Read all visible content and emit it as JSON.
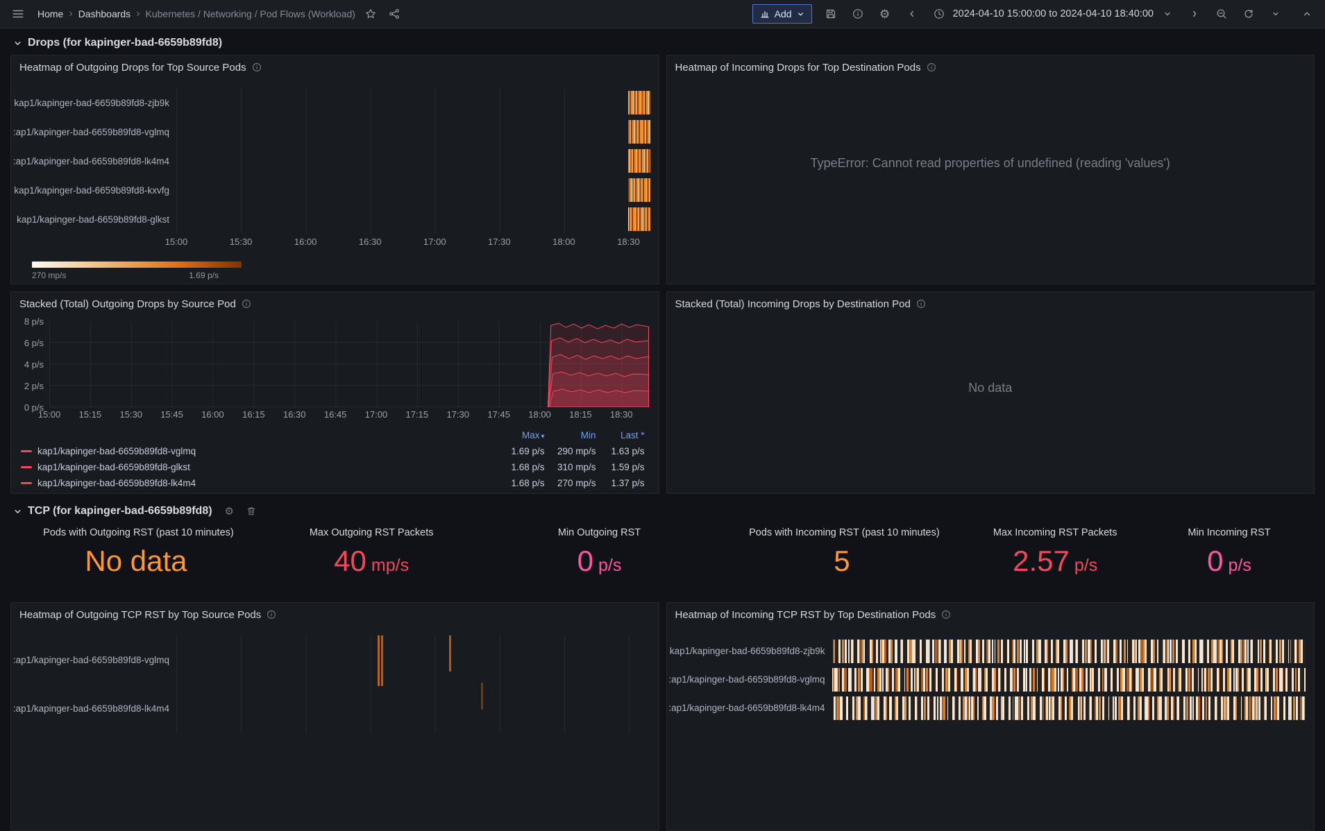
{
  "nav": {
    "breadcrumb": {
      "home": "Home",
      "dashboards": "Dashboards",
      "current": "Kubernetes / Networking / Pod Flows (Workload)"
    },
    "add_label": "Add",
    "time_range": "2024-04-10 15:00:00 to 2024-04-10 18:40:00"
  },
  "icons": {
    "breadcrumb_separator": "›",
    "gear": "⚙",
    "sort_caret": "▾"
  },
  "colors": {
    "accent_blue": "#4e78d0",
    "red": "#f2495c",
    "orange": "#ff9830",
    "pink": "#ff55a3",
    "heatmap_orange": "#e8772a",
    "legend_link_blue": "#6e9fff"
  },
  "row_drops": {
    "title": "Drops (for kapinger-bad-6659b89fd8)"
  },
  "row_tcp": {
    "title": "TCP (for kapinger-bad-6659b89fd8)"
  },
  "heatmap_out_drops": {
    "title": "Heatmap of Outgoing Drops for Top Source Pods",
    "y_labels": [
      "kap1/kapinger-bad-6659b89fd8-zjb9k",
      ":ap1/kapinger-bad-6659b89fd8-vglmq",
      ":ap1/kapinger-bad-6659b89fd8-lk4m4",
      "kap1/kapinger-bad-6659b89fd8-kxvfg",
      "kap1/kapinger-bad-6659b89fd8-glkst"
    ],
    "x_ticks": [
      "15:00",
      "15:30",
      "16:00",
      "16:30",
      "17:00",
      "17:30",
      "18:00",
      "18:30"
    ],
    "scale_min": "270 mp/s",
    "scale_max": "1.69 p/s"
  },
  "heatmap_in_drops": {
    "title": "Heatmap of Incoming Drops for Top Destination Pods",
    "error": "TypeError: Cannot read properties of undefined (reading 'values')"
  },
  "stacked_out": {
    "title": "Stacked (Total) Outgoing Drops by Source Pod",
    "y_ticks": [
      "8 p/s",
      "6 p/s",
      "4 p/s",
      "2 p/s",
      "0 p/s"
    ],
    "x_ticks": [
      "15:00",
      "15:15",
      "15:30",
      "15:45",
      "16:00",
      "16:15",
      "16:30",
      "16:45",
      "17:00",
      "17:15",
      "17:30",
      "17:45",
      "18:00",
      "18:15",
      "18:30"
    ],
    "legend_cols": {
      "max": "Max",
      "min": "Min",
      "last": "Last *"
    },
    "legend_rows": [
      {
        "name": "kap1/kapinger-bad-6659b89fd8-vglmq",
        "max": "1.69 p/s",
        "min": "290 mp/s",
        "last": "1.63 p/s"
      },
      {
        "name": "kap1/kapinger-bad-6659b89fd8-glkst",
        "max": "1.68 p/s",
        "min": "310 mp/s",
        "last": "1.59 p/s"
      },
      {
        "name": "kap1/kapinger-bad-6659b89fd8-lk4m4",
        "max": "1.68 p/s",
        "min": "270 mp/s",
        "last": "1.37 p/s"
      }
    ]
  },
  "stacked_in": {
    "title": "Stacked (Total) Incoming Drops by Destination Pod",
    "message": "No data"
  },
  "stats": [
    {
      "title": "Pods with Outgoing RST (past 10 minutes)",
      "value": "No data",
      "unit": "",
      "color": "#ff9830"
    },
    {
      "title": "Max Outgoing RST Packets",
      "value": "40",
      "unit": "mp/s",
      "color": "#f2495c"
    },
    {
      "title": "Min Outgoing RST",
      "value": "0",
      "unit": "p/s",
      "color": "#ff55a3"
    },
    {
      "title": "Pods with Incoming RST (past 10 minutes)",
      "value": "5",
      "unit": "",
      "color": "#ff9830"
    },
    {
      "title": "Max Incoming RST Packets",
      "value": "2.57",
      "unit": "p/s",
      "color": "#f2495c"
    },
    {
      "title": "Min Incoming RST",
      "value": "0",
      "unit": "p/s",
      "color": "#ff55a3"
    }
  ],
  "heatmap_out_rst": {
    "title": "Heatmap of Outgoing TCP RST by Top Source Pods",
    "y_labels": [
      ":ap1/kapinger-bad-6659b89fd8-vglmq",
      ":ap1/kapinger-bad-6659b89fd8-lk4m4"
    ]
  },
  "heatmap_in_rst": {
    "title": "Heatmap of Incoming TCP RST by Top Destination Pods",
    "y_labels": [
      "kap1/kapinger-bad-6659b89fd8-zjb9k",
      ":ap1/kapinger-bad-6659b89fd8-vglmq",
      ":ap1/kapinger-bad-6659b89fd8-lk4m4"
    ]
  },
  "chart_data": [
    {
      "type": "heatmap",
      "title": "Heatmap of Outgoing Drops for Top Source Pods",
      "y_categories": [
        "kap1/kapinger-bad-6659b89fd8-zjb9k",
        ":ap1/kapinger-bad-6659b89fd8-vglmq",
        ":ap1/kapinger-bad-6659b89fd8-lk4m4",
        "kap1/kapinger-bad-6659b89fd8-kxvfg",
        "kap1/kapinger-bad-6659b89fd8-glkst"
      ],
      "x_ticks": [
        "15:00",
        "15:30",
        "16:00",
        "16:30",
        "17:00",
        "17:30",
        "18:00",
        "18:30"
      ],
      "x_range": [
        "15:00",
        "18:40"
      ],
      "color_scale": {
        "min_label": "270 mp/s",
        "max_label": "1.69 p/s"
      },
      "cells_note": "all five pods show orange drop activity only between ~18:28 and 18:40; rest of range empty"
    },
    {
      "type": "area",
      "stacked": true,
      "title": "Stacked (Total) Outgoing Drops by Source Pod",
      "ylim": [
        0,
        8
      ],
      "y_ticks": [
        "0 p/s",
        "2 p/s",
        "4 p/s",
        "6 p/s",
        "8 p/s"
      ],
      "x_ticks": [
        "15:00",
        "15:15",
        "15:30",
        "15:45",
        "16:00",
        "16:15",
        "16:30",
        "16:45",
        "17:00",
        "17:15",
        "17:30",
        "17:45",
        "18:00",
        "18:15",
        "18:30"
      ],
      "series": [
        {
          "name": "kap1/kapinger-bad-6659b89fd8-vglmq",
          "max": "1.69 p/s",
          "min": "290 mp/s",
          "last": "1.63 p/s"
        },
        {
          "name": "kap1/kapinger-bad-6659b89fd8-glkst",
          "max": "1.68 p/s",
          "min": "310 mp/s",
          "last": "1.59 p/s"
        },
        {
          "name": "kap1/kapinger-bad-6659b89fd8-lk4m4",
          "max": "1.68 p/s",
          "min": "270 mp/s",
          "last": "1.37 p/s"
        }
      ],
      "shape_note": "near zero until ~18:03, then five stacked red series rise sharply to a wiggly total of ~8 p/s through 18:40",
      "legend_position": "bottom-table"
    },
    {
      "type": "stat",
      "values": [
        {
          "title": "Pods with Outgoing RST (past 10 minutes)",
          "value": "No data"
        },
        {
          "title": "Max Outgoing RST Packets",
          "value": "40 mp/s"
        },
        {
          "title": "Min Outgoing RST",
          "value": "0 p/s"
        },
        {
          "title": "Pods with Incoming RST (past 10 minutes)",
          "value": "5"
        },
        {
          "title": "Max Incoming RST Packets",
          "value": "2.57 p/s"
        },
        {
          "title": "Min Incoming RST",
          "value": "0 p/s"
        }
      ]
    },
    {
      "type": "heatmap",
      "title": "Heatmap of Outgoing TCP RST by Top Source Pods",
      "y_categories": [
        ":ap1/kapinger-bad-6659b89fd8-vglmq",
        ":ap1/kapinger-bad-6659b89fd8-lk4m4"
      ],
      "cells_note": "sparse: two thin orange bursts ~17:00, one ~17:25, one darker ~17:40"
    },
    {
      "type": "heatmap",
      "title": "Heatmap of Incoming TCP RST by Top Destination Pods",
      "y_categories": [
        "kap1/kapinger-bad-6659b89fd8-zjb9k",
        ":ap1/kapinger-bad-6659b89fd8-vglmq",
        ":ap1/kapinger-bad-6659b89fd8-lk4m4"
      ],
      "cells_note": "dense cream/orange activity across the entire visible time range for all rows"
    }
  ]
}
